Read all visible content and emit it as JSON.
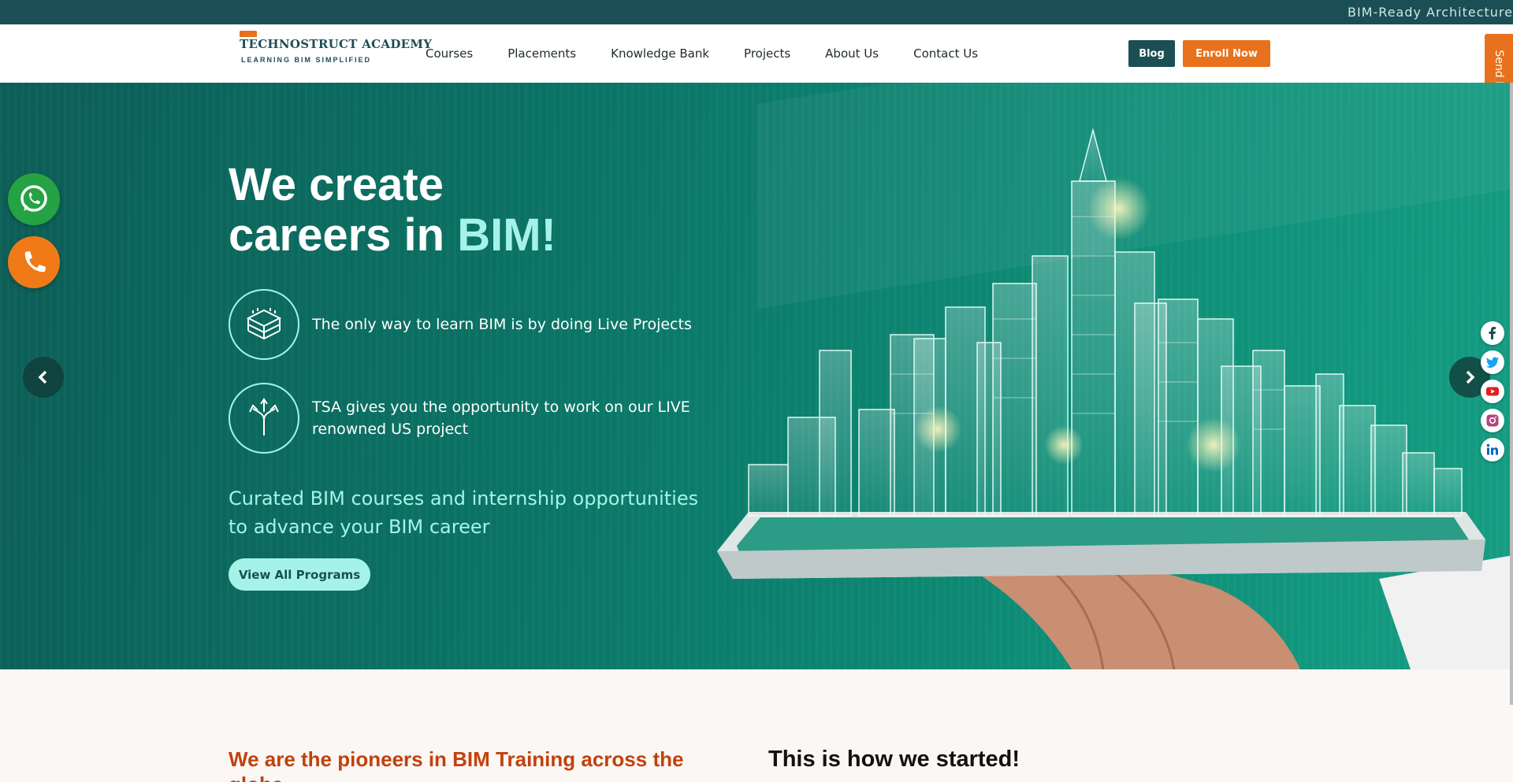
{
  "topbar": {
    "ticker": "BIM-Ready Architecture"
  },
  "header": {
    "logo": {
      "name": "TECHNOSTRUCT ACADEMY",
      "tagline": "LEARNING BIM SIMPLIFIED"
    },
    "nav": [
      "Courses",
      "Placements",
      "Knowledge Bank",
      "Projects",
      "About Us",
      "Contact Us"
    ],
    "blog_label": "Blog",
    "enroll_label": "Enroll Now",
    "enquiry_label": "Send Enquiry"
  },
  "hero": {
    "title_line1": "We create",
    "title_line2_prefix": "careers in ",
    "title_accent": "BIM!",
    "feature1": "The only way to learn BIM is by doing Live Projects",
    "feature2": "TSA gives you the opportunity to work on our LIVE renowned US project",
    "tagline": "Curated BIM courses and internship opportunities to advance your BIM career",
    "cta_label": "View All Programs"
  },
  "icons": {
    "whatsapp": "whatsapp-icon",
    "phone": "phone-icon",
    "prev": "chevron-left-icon",
    "next": "chevron-right-icon",
    "socials": [
      "facebook-icon",
      "twitter-icon",
      "youtube-icon",
      "instagram-icon",
      "linkedin-icon"
    ]
  },
  "colors": {
    "brand_dark": "#1b4e55",
    "brand_orange": "#e8711d",
    "accent_mint": "#a5f3e8",
    "pioneer_text": "#c2410c"
  },
  "lower": {
    "pioneers_heading": "We are the pioneers in BIM Training across the globe",
    "started_heading": "This is how we started!"
  }
}
